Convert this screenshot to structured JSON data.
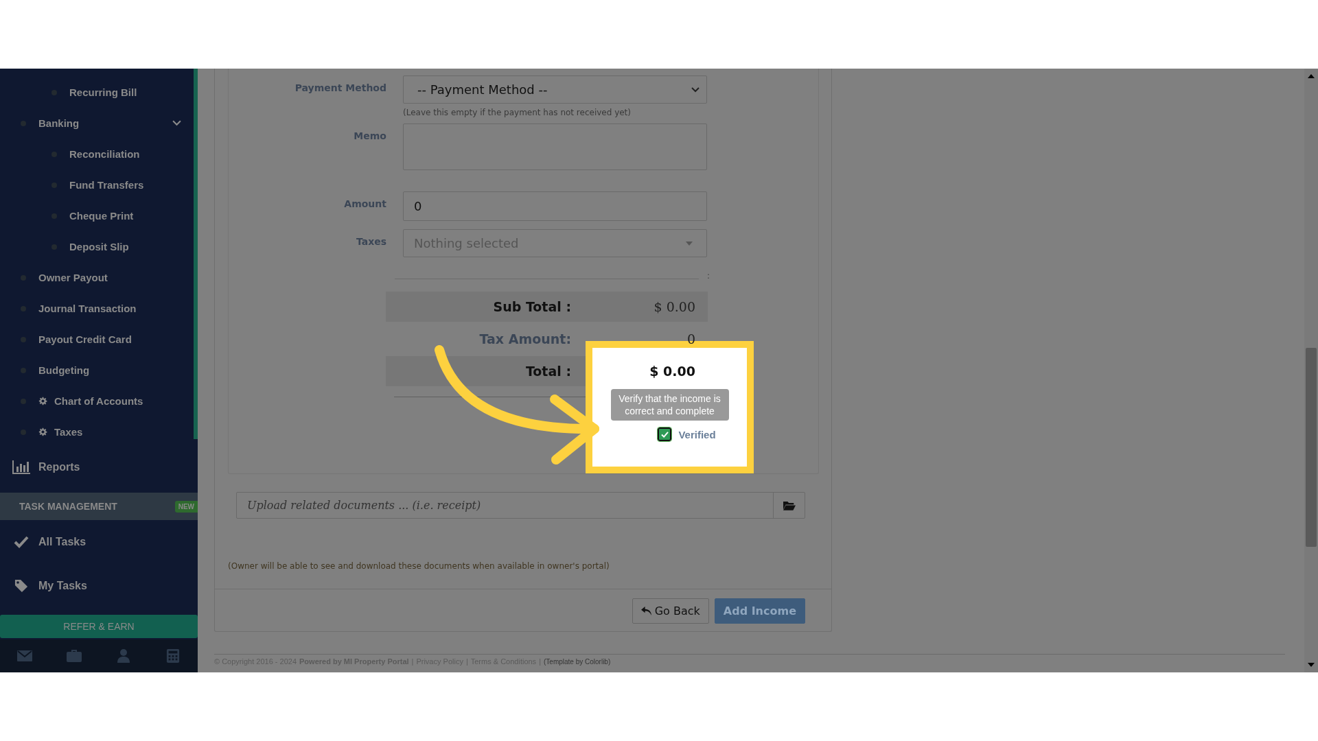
{
  "sidebar": {
    "items": [
      {
        "label": "Recurring Bill",
        "kind": "sub"
      },
      {
        "label": "Banking",
        "kind": "group",
        "expanded": true,
        "children": [
          {
            "label": "Reconciliation"
          },
          {
            "label": "Fund Transfers"
          },
          {
            "label": "Cheque Print"
          },
          {
            "label": "Deposit Slip"
          }
        ]
      },
      {
        "label": "Owner Payout",
        "kind": "item"
      },
      {
        "label": "Journal Transaction",
        "kind": "item"
      },
      {
        "label": "Payout Credit Card",
        "kind": "item"
      },
      {
        "label": "Budgeting",
        "kind": "item"
      },
      {
        "label": "Chart of Accounts",
        "kind": "gear"
      },
      {
        "label": "Taxes",
        "kind": "gear"
      }
    ],
    "reports": "Reports",
    "task_section": {
      "title": "TASK MANAGEMENT",
      "badge": "NEW"
    },
    "task_items": [
      {
        "label": "All Tasks",
        "kind": "check"
      },
      {
        "label": "My Tasks",
        "kind": "tag"
      }
    ],
    "refer_button": "REFER & EARN",
    "bottom_icons": [
      {
        "kind": "mail"
      },
      {
        "kind": "briefcase"
      },
      {
        "kind": "user"
      },
      {
        "kind": "calculator"
      }
    ]
  },
  "form": {
    "payment_method": {
      "label": "Payment Method",
      "value": "-- Payment Method --",
      "hint": "(Leave this empty if the payment has not received yet)"
    },
    "memo": {
      "label": "Memo"
    },
    "amount": {
      "label": "Amount",
      "value": "0"
    },
    "taxes": {
      "label": "Taxes",
      "placeholder": "Nothing selected"
    },
    "separator_mark": ":",
    "totals": [
      {
        "label": "Sub Total :",
        "value": "$ 0.00",
        "kind": "band"
      },
      {
        "label": "Tax Amount:",
        "value": "0",
        "kind": "plain"
      },
      {
        "label": "Total :",
        "value": "$ 0.00",
        "kind": "band"
      }
    ],
    "tooltip": "Verify that the income is correct and complete",
    "verified": {
      "label": "Verified",
      "checked": true
    }
  },
  "upload": {
    "placeholder": "Upload related documents ... (i.e. receipt)",
    "note": "(Owner will be able to see and download these documents when available in owner's portal)"
  },
  "buttons": [
    {
      "label": "Go Back",
      "kind": "secondary"
    },
    {
      "label": "Add Income",
      "kind": "primary"
    }
  ],
  "footer": {
    "copyright": "© Copyright 2016 - 2024",
    "powered": "Powered by MI Property Portal",
    "links": [
      "Privacy Policy",
      "Terms & Conditions"
    ],
    "separator": "|",
    "template": "(Template by Colorlib)"
  }
}
